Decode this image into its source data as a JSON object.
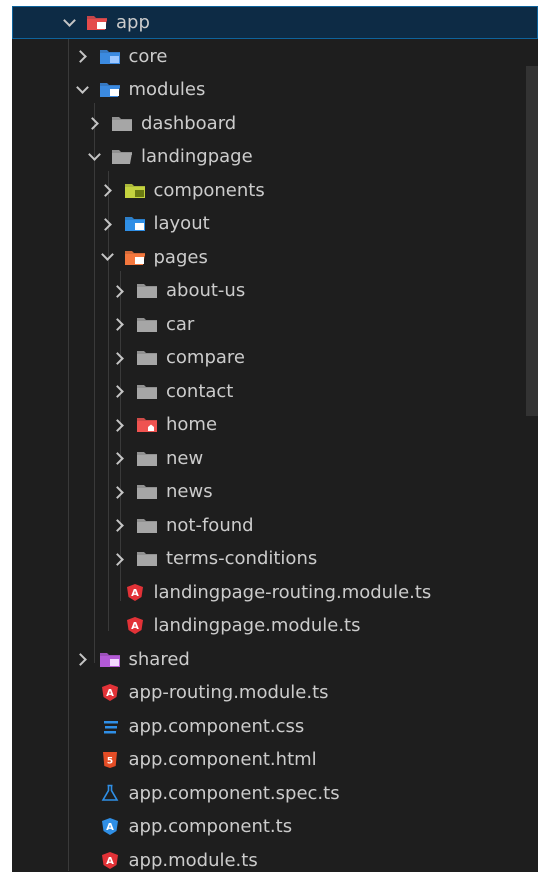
{
  "tree": [
    {
      "label": "app",
      "twisty": "open",
      "icon": "app-folder-icon",
      "depth": 0,
      "color": "#e44b4b",
      "selected": true
    },
    {
      "label": "core",
      "twisty": "closed",
      "icon": "core-folder-icon",
      "depth": 1,
      "color": "#3b8ae0"
    },
    {
      "label": "modules",
      "twisty": "open",
      "icon": "modules-folder-icon",
      "depth": 1,
      "color": "#3b8ae0"
    },
    {
      "label": "dashboard",
      "twisty": "closed",
      "icon": "folder-icon",
      "depth": 2,
      "color": "#a6a6a6"
    },
    {
      "label": "landingpage",
      "twisty": "open",
      "icon": "folder-open-icon",
      "depth": 2,
      "color": "#a6a6a6"
    },
    {
      "label": "components",
      "twisty": "closed",
      "icon": "components-folder-icon",
      "depth": 3,
      "color": "#c4d33f"
    },
    {
      "label": "layout",
      "twisty": "closed",
      "icon": "layout-folder-icon",
      "depth": 3,
      "color": "#2f8fe6"
    },
    {
      "label": "pages",
      "twisty": "open",
      "icon": "pages-folder-icon",
      "depth": 3,
      "color": "#f4773d"
    },
    {
      "label": "about-us",
      "twisty": "closed",
      "icon": "folder-icon",
      "depth": 4,
      "color": "#a6a6a6"
    },
    {
      "label": "car",
      "twisty": "closed",
      "icon": "folder-icon",
      "depth": 4,
      "color": "#a6a6a6"
    },
    {
      "label": "compare",
      "twisty": "closed",
      "icon": "folder-icon",
      "depth": 4,
      "color": "#a6a6a6"
    },
    {
      "label": "contact",
      "twisty": "closed",
      "icon": "folder-icon",
      "depth": 4,
      "color": "#a6a6a6"
    },
    {
      "label": "home",
      "twisty": "closed",
      "icon": "home-folder-icon",
      "depth": 4,
      "color": "#ef5350"
    },
    {
      "label": "new",
      "twisty": "closed",
      "icon": "folder-icon",
      "depth": 4,
      "color": "#a6a6a6"
    },
    {
      "label": "news",
      "twisty": "closed",
      "icon": "folder-icon",
      "depth": 4,
      "color": "#a6a6a6"
    },
    {
      "label": "not-found",
      "twisty": "closed",
      "icon": "folder-icon",
      "depth": 4,
      "color": "#a6a6a6"
    },
    {
      "label": "terms-conditions",
      "twisty": "closed",
      "icon": "folder-icon",
      "depth": 4,
      "color": "#a6a6a6"
    },
    {
      "label": "landingpage-routing.module.ts",
      "twisty": "none",
      "icon": "angular-icon",
      "depth": 3,
      "color": "#e23237"
    },
    {
      "label": "landingpage.module.ts",
      "twisty": "none",
      "icon": "angular-icon",
      "depth": 3,
      "color": "#e23237"
    },
    {
      "label": "shared",
      "twisty": "closed",
      "icon": "shared-folder-icon",
      "depth": 1,
      "color": "#b35ad6"
    },
    {
      "label": "app-routing.module.ts",
      "twisty": "none",
      "icon": "angular-icon",
      "depth": 1,
      "color": "#e23237"
    },
    {
      "label": "app.component.css",
      "twisty": "none",
      "icon": "css-icon",
      "depth": 1,
      "color": "#2f8fe6"
    },
    {
      "label": "app.component.html",
      "twisty": "none",
      "icon": "html-icon",
      "depth": 1,
      "color": "#e44d26"
    },
    {
      "label": "app.component.spec.ts",
      "twisty": "none",
      "icon": "test-flask-icon",
      "depth": 1,
      "color": "#2f8fe6"
    },
    {
      "label": "app.component.ts",
      "twisty": "none",
      "icon": "angular-component-icon",
      "depth": 1,
      "color": "#2f8fe6"
    },
    {
      "label": "app.module.ts",
      "twisty": "none",
      "icon": "angular-icon",
      "depth": 1,
      "color": "#e23237"
    }
  ]
}
